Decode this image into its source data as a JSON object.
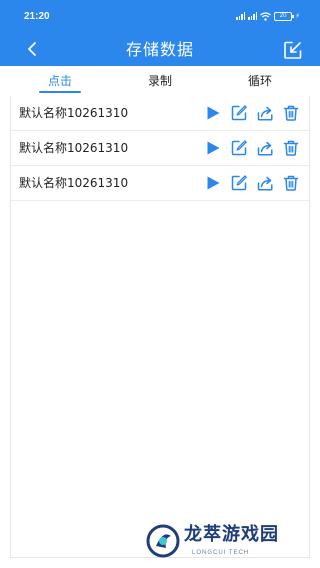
{
  "status_bar": {
    "time": "21:20",
    "battery": "20"
  },
  "header": {
    "title": "存储数据"
  },
  "tabs": [
    {
      "label": "点击",
      "active": true
    },
    {
      "label": "录制",
      "active": false
    },
    {
      "label": "循环",
      "active": false
    }
  ],
  "records": [
    {
      "name": "默认名称10261310"
    },
    {
      "name": "默认名称10261310"
    },
    {
      "name": "默认名称10261310"
    }
  ],
  "row_actions": [
    "play-icon",
    "edit-icon",
    "share-icon",
    "delete-icon"
  ],
  "watermark": {
    "title": "龙萃游戏园",
    "subtitle": "LONGCUI TECH"
  },
  "colors": {
    "primary": "#2b87ec",
    "background": "#ffffff",
    "text": "#222222"
  }
}
